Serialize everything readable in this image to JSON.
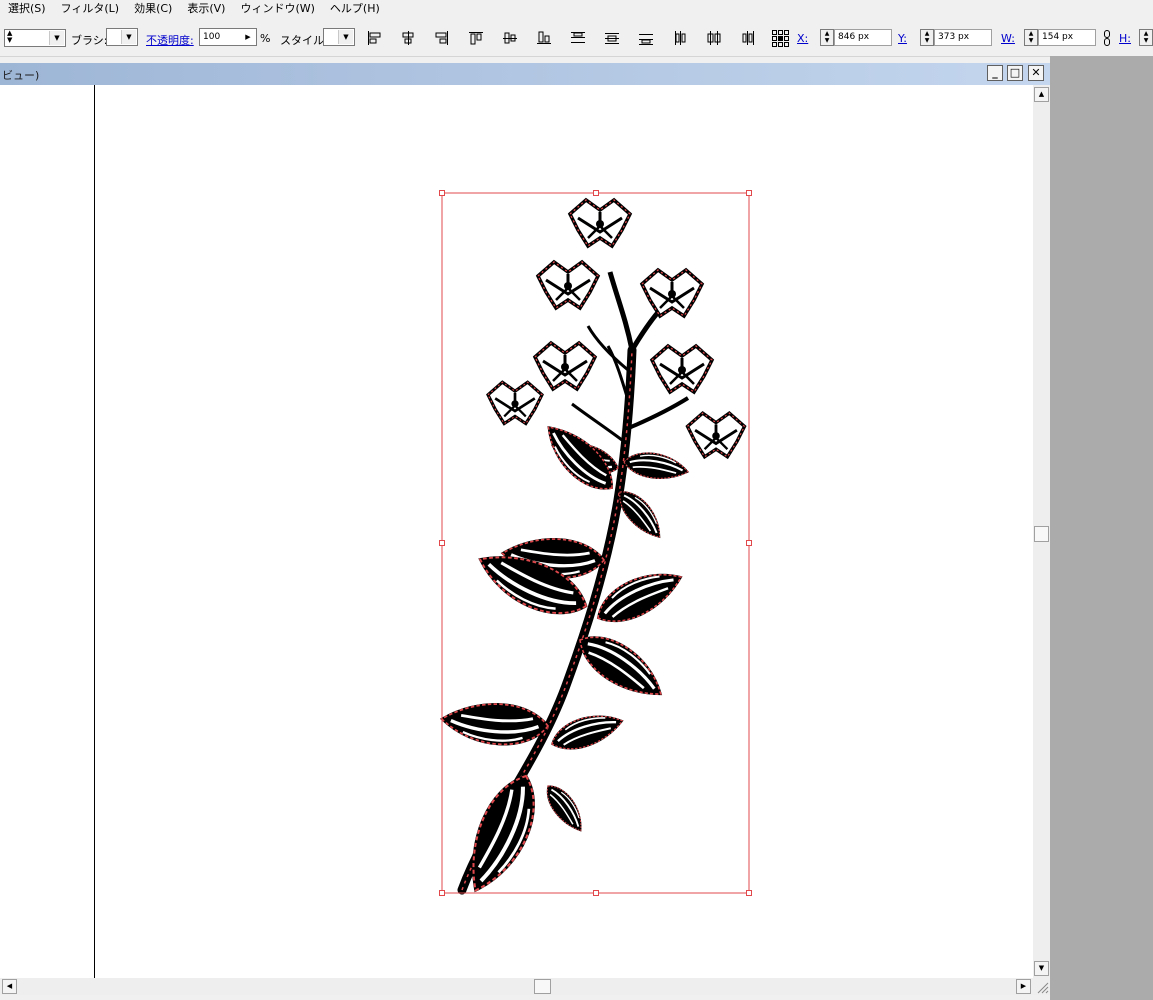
{
  "menu": {
    "items": [
      "選択(S)",
      "フィルタ(L)",
      "効果(C)",
      "表示(V)",
      "ウィンドウ(W)",
      "ヘルプ(H)"
    ]
  },
  "toolbar": {
    "brush_label": "ブラシ:",
    "opacity_label": "不透明度:",
    "opacity_value": "100",
    "percent": "%",
    "style_label": "スタイル:",
    "x_label": "X:",
    "x_value": "846 px",
    "y_label": "Y:",
    "y_value": "373 px",
    "w_label": "W:",
    "w_value": "154 px",
    "h_label": "H:"
  },
  "document": {
    "title": "ビュー)"
  },
  "colors": {
    "selection": "#e0484c",
    "titlebar_start": "#9eb6d6",
    "titlebar_end": "#c4d6ee",
    "workspace": "#ababab"
  }
}
